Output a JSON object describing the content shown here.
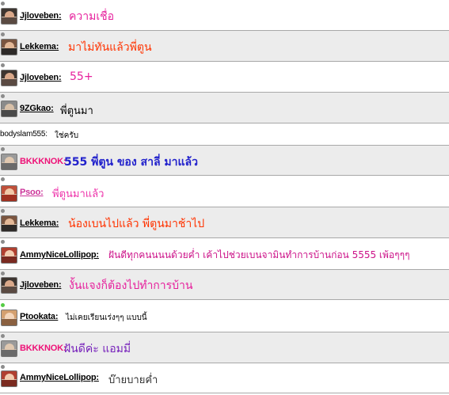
{
  "messages": [
    {
      "user": "Jjloveben:",
      "text": "ความเชื่อ",
      "name_color": "#000000",
      "text_color": "#e61f9c",
      "row_style": "plain",
      "avatar": "photo-dark"
    },
    {
      "user": "Lekkema:",
      "text": "มาไม่ทันแล้วพี่ตูน",
      "name_color": "#000000",
      "text_color": "#ff3300",
      "row_style": "alt",
      "avatar": "photo-duo"
    },
    {
      "user": "Jjloveben:",
      "text": "55+",
      "name_color": "#000000",
      "text_color": "#e61f9c",
      "row_style": "plain",
      "avatar": "photo-dark"
    },
    {
      "user": "9ZGkao:",
      "text": "พี่ตูนมา",
      "name_color": "#000000",
      "text_color": "#000000",
      "row_style": "alt",
      "avatar": "photo-grey"
    },
    {
      "user": "bodyslam555:",
      "text": "ใช่ครับ",
      "name_color": "#000000",
      "text_color": "#000000",
      "row_style": "plain",
      "avatar": ""
    },
    {
      "user": "BKKKNOK:",
      "text": "555 พี่ตูน ของ สาลี่ มาแล้ว",
      "name_color": "#ee1177",
      "text_color": "#2222cc",
      "row_style": "alt",
      "avatar": "photo-grey"
    },
    {
      "user": "Psoo:",
      "text": "พี่ตูนมาแล้ว",
      "name_color": "#cc3399",
      "text_color": "#ee33aa",
      "row_style": "plain",
      "avatar": "photo-warm"
    },
    {
      "user": "Lekkema:",
      "text": "น้องเบนไปแล้ว พี่ตูนมาช้าไป",
      "name_color": "#000000",
      "text_color": "#ff3300",
      "row_style": "alt",
      "avatar": "photo-duo"
    },
    {
      "user": "AmmyNiceLollipop:",
      "text": "ฝันดีทุกคนนนนด้วยค่ำ เค้าไปช่วยเบนจามินทำการบ้านก่อน 5555 เพ้อๆๆๆ",
      "name_color": "#000000",
      "text_color": "#cc1188",
      "row_style": "plain",
      "avatar": "photo-red"
    },
    {
      "user": "Jjloveben:",
      "text": "งั้นแจงก็ต้องไปทำการบ้าน",
      "name_color": "#000000",
      "text_color": "#e61f9c",
      "row_style": "alt",
      "avatar": "photo-dark"
    },
    {
      "user": "Ptookata:",
      "text": "ไม่เคยเรียนเร่งๆๆ แบบนี้",
      "name_color": "#000000",
      "text_color": "#000000",
      "row_style": "plain",
      "avatar": "photo-warm"
    },
    {
      "user": "BKKKNOK:",
      "text": "ฝันดีค่ะ แอมมี่",
      "name_color": "#ee1177",
      "text_color": "#7722bb",
      "row_style": "alt",
      "avatar": "photo-grey"
    },
    {
      "user": "AmmyNiceLollipop:",
      "text": "บ๊ายบายค่ำ",
      "name_color": "#000000",
      "text_color": "#333333",
      "row_style": "plain",
      "avatar": "photo-red"
    }
  ]
}
